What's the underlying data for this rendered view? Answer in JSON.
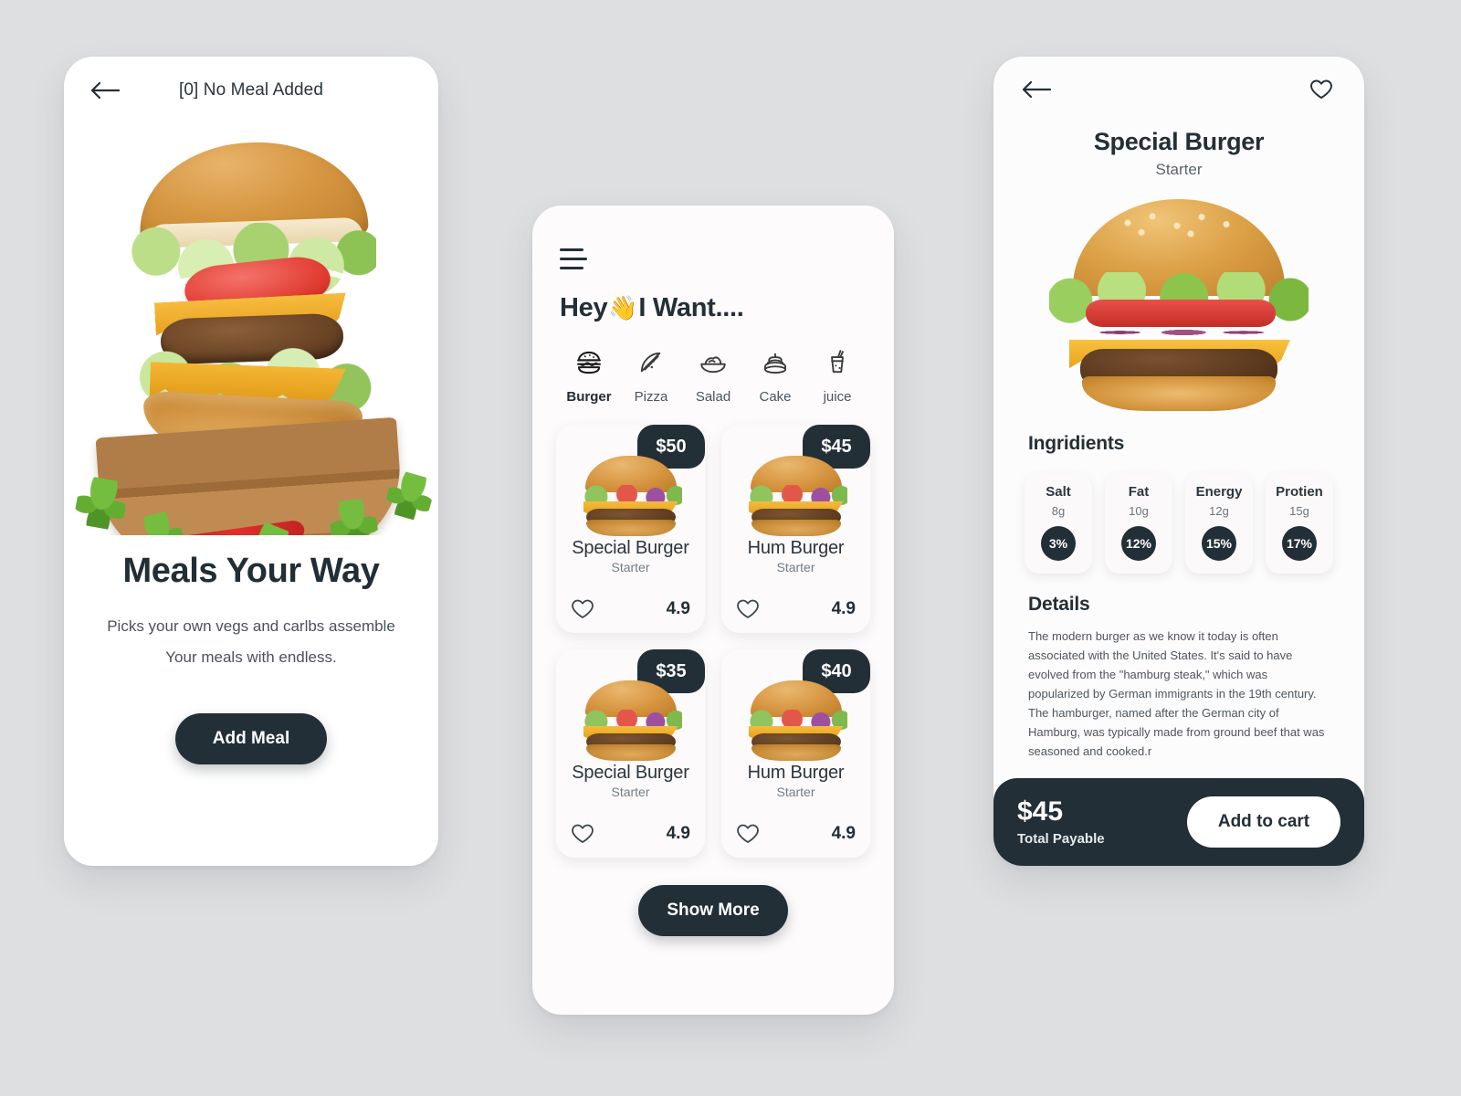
{
  "theme": {
    "page_bg": "#dedfe1",
    "dark": "#232f36",
    "card_bg": "#fcfafb",
    "muted_text": "#6b757b"
  },
  "screen_onboarding": {
    "back_icon": "arrow-left-icon",
    "header_title": "[0] No Meal Added",
    "hero_image_alt": "stacked-burger-on-wooden-board",
    "headline": "Meals Your Way",
    "subtitle_line1": "Picks your own vegs and carlbs assemble",
    "subtitle_line2": "Your meals with endless.",
    "cta_label": "Add Meal"
  },
  "screen_menu": {
    "menu_icon": "hamburger-menu-icon",
    "greeting_prefix": "Hey",
    "greeting_emoji": "👋",
    "greeting_suffix": "I Want....",
    "categories": [
      {
        "label": "Burger",
        "icon": "burger-icon",
        "active": true
      },
      {
        "label": "Pizza",
        "icon": "pizza-icon",
        "active": false
      },
      {
        "label": "Salad",
        "icon": "salad-icon",
        "active": false
      },
      {
        "label": "Cake",
        "icon": "cake-icon",
        "active": false
      },
      {
        "label": "juice",
        "icon": "juice-cup-icon",
        "active": false
      }
    ],
    "products": [
      {
        "price": "$50",
        "name": "Special Burger",
        "sub": "Starter",
        "rating": "4.9",
        "favorite_icon": "heart-outline-icon"
      },
      {
        "price": "$45",
        "name": "Hum Burger",
        "sub": "Starter",
        "rating": "4.9",
        "favorite_icon": "heart-outline-icon"
      },
      {
        "price": "$35",
        "name": "Special Burger",
        "sub": "Starter",
        "rating": "4.9",
        "favorite_icon": "heart-outline-icon"
      },
      {
        "price": "$40",
        "name": "Hum Burger",
        "sub": "Starter",
        "rating": "4.9",
        "favorite_icon": "heart-outline-icon"
      }
    ],
    "show_more_label": "Show More"
  },
  "screen_detail": {
    "back_icon": "arrow-left-icon",
    "favorite_icon": "heart-outline-icon",
    "title": "Special Burger",
    "subtitle": "Starter",
    "hero_image_alt": "special-burger-closeup",
    "ingredients_heading": "Ingridients",
    "nutrients": [
      {
        "name": "Salt",
        "amount": "8g",
        "percent": "3%"
      },
      {
        "name": "Fat",
        "amount": "10g",
        "percent": "12%"
      },
      {
        "name": "Energy",
        "amount": "12g",
        "percent": "15%"
      },
      {
        "name": "Protien",
        "amount": "15g",
        "percent": "17%"
      }
    ],
    "details_heading": "Details",
    "details_text": "The modern burger as we know it today is often associated with the United States. It's said to have evolved from the \"hamburg steak,\" which was popularized by German immigrants in the 19th century. The hamburger, named after the German city of Hamburg, was typically made from ground beef that was seasoned and cooked.r",
    "total_amount": "$45",
    "total_label": "Total Payable",
    "add_to_cart_label": "Add to cart"
  }
}
